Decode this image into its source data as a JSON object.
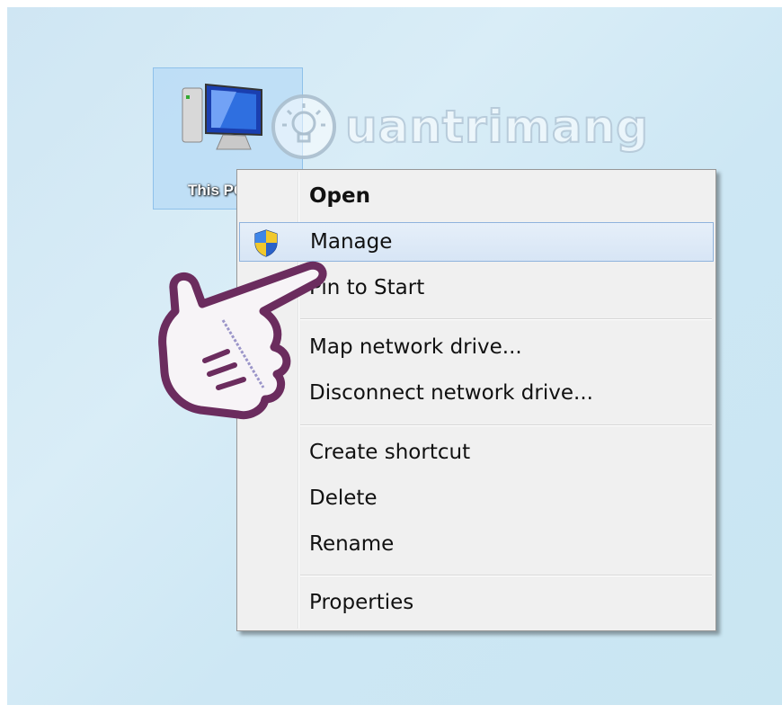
{
  "desktop": {
    "icon": {
      "label": "This PC",
      "icon_name": "computer-monitor-icon"
    },
    "watermark": {
      "text": "uantrimang",
      "icon_name": "lightbulb-logo"
    }
  },
  "context_menu": {
    "items": [
      {
        "label": "Open",
        "bold": true
      },
      {
        "label": "Manage",
        "highlighted": true,
        "icon": "uac-shield-icon"
      },
      {
        "label": "Pin to Start"
      },
      {
        "label": "Map network drive..."
      },
      {
        "label": "Disconnect network drive..."
      },
      {
        "label": "Create shortcut"
      },
      {
        "label": "Delete"
      },
      {
        "label": "Rename"
      },
      {
        "label": "Properties"
      }
    ]
  },
  "annotation": {
    "icon_name": "pointing-hand-icon"
  },
  "colors": {
    "desktop": "#d3eaf5",
    "highlight": "#dce8f6",
    "highlight_border": "#8fb3dd",
    "menu_bg": "#f0f0f0"
  }
}
